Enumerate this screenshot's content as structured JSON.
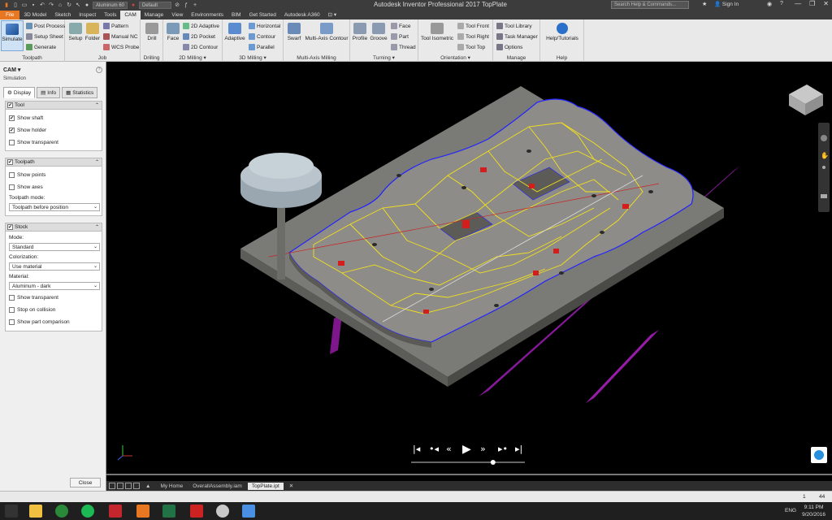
{
  "titlebar": {
    "material": "Aluminum 60",
    "appearance": "Default",
    "title": "Autodesk Inventor Professional 2017    TopPlate",
    "search_placeholder": "Search Help & Commands...",
    "signin": "Sign In"
  },
  "tabs": [
    "File",
    "3D Model",
    "Sketch",
    "Inspect",
    "Tools",
    "CAM",
    "Manage",
    "View",
    "Environments",
    "BIM",
    "Get Started",
    "Autodesk A360"
  ],
  "ribbon": {
    "toolpath": {
      "title": "Toolpath",
      "simulate": "Simulate",
      "post_process": "Post Process",
      "setup_sheet": "Setup Sheet",
      "generate": "Generate"
    },
    "job": {
      "title": "Job",
      "setup": "Setup",
      "folder": "Folder",
      "pattern": "Pattern",
      "manual_nc": "Manual NC",
      "wcs_probe": "WCS Probe"
    },
    "drilling": {
      "title": "Drilling",
      "drill": "Drill"
    },
    "milling2d": {
      "title": "2D Milling",
      "face": "Face",
      "adaptive": "2D Adaptive",
      "pocket": "2D Pocket",
      "contour": "2D Contour"
    },
    "milling3d": {
      "title": "3D Milling",
      "adaptive": "Adaptive",
      "horizontal": "Horizontal",
      "contour": "Contour",
      "parallel": "Parallel"
    },
    "multiaxis": {
      "title": "Multi-Axis Milling",
      "swarf": "Swarf",
      "multi_axis_contour": "Multi-Axis Contour"
    },
    "turning": {
      "title": "Turning",
      "profile": "Profile",
      "groove": "Groove",
      "face": "Face",
      "part": "Part",
      "thread": "Thread"
    },
    "orientation": {
      "title": "Orientation",
      "tool_isometric": "Tool Isometric",
      "tool_front": "Tool Front",
      "tool_right": "Tool Right",
      "tool_top": "Tool Top"
    },
    "manage": {
      "title": "Manage",
      "tool_library": "Tool Library",
      "task_manager": "Task Manager",
      "options": "Options"
    },
    "help": {
      "title": "Help",
      "tutorials": "Help/Tutorials"
    }
  },
  "left_panel": {
    "header": "CAM",
    "subtitle": "Simulation",
    "tabs": [
      "Display",
      "Info",
      "Statistics"
    ],
    "tool_group": {
      "title": "Tool",
      "show_shaft": "Show shaft",
      "show_holder": "Show holder",
      "show_transparent": "Show transparent"
    },
    "toolpath_group": {
      "title": "Toolpath",
      "show_points": "Show points",
      "show_axes": "Show axes",
      "mode_label": "Toolpath mode:",
      "mode_value": "Toolpath before position"
    },
    "stock_group": {
      "title": "Stock",
      "mode_label": "Mode:",
      "mode_value": "Standard",
      "colorization_label": "Colorization:",
      "colorization_value": "Use material",
      "material_label": "Material:",
      "material_value": "Aluminum - dark",
      "show_transparent": "Show transparent",
      "stop_on_collision": "Stop on collision",
      "show_part_comparison": "Show part comparison"
    },
    "close": "Close"
  },
  "doc_tabs": [
    "My Home",
    "OverallAssembly.iam",
    "TopPlate.ipt"
  ],
  "status": {
    "page": "1",
    "count": "44"
  },
  "clock": {
    "time": "9:11 PM",
    "date": "9/20/2016"
  },
  "lang": "ENG",
  "colors": {
    "accent": "#e87722",
    "toolpath": "#f5e21b",
    "boundary": "#2222ff",
    "plane": "#b320c8"
  },
  "playback": {
    "progress": 0.72
  }
}
